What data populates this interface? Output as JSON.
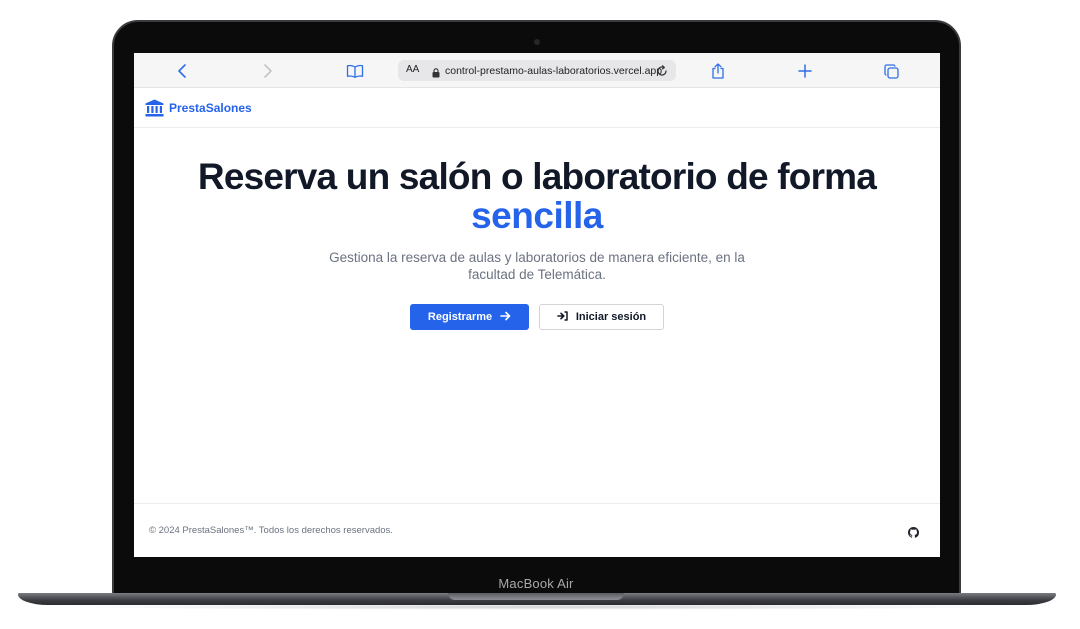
{
  "device": {
    "label": "MacBook Air"
  },
  "browser": {
    "text_size_label": "AA",
    "url": "control-prestamo-aulas-laboratorios.vercel.app",
    "icons": [
      "chevron-left-icon",
      "chevron-right-icon",
      "book-icon",
      "lock-icon",
      "reload-icon",
      "share-icon",
      "plus-icon",
      "tabs-icon"
    ]
  },
  "header": {
    "brand": "PrestaSalones",
    "logo_icon": "institution-icon",
    "brand_color": "#2563eb"
  },
  "hero": {
    "title": "Reserva un salón o laboratorio de forma",
    "title_accent": "sencilla",
    "subtitle": "Gestiona la reserva de aulas y laboratorios de manera eficiente, en la facultad de Telemática.",
    "primary_button": "Registrarme",
    "secondary_button": "Iniciar sesión"
  },
  "footer": {
    "copyright": "© 2024 PrestaSalones™. Todos los derechos reservados.",
    "social_icon": "github-icon"
  }
}
